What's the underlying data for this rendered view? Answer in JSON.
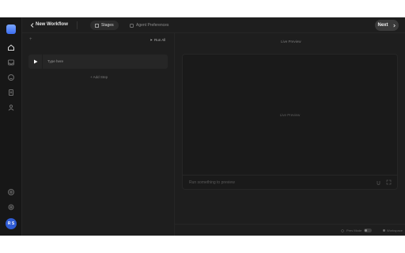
{
  "header": {
    "title": "New Workflow",
    "tabs": [
      {
        "label": "Stages",
        "active": true
      },
      {
        "label": "Agent Preferences",
        "active": false
      }
    ],
    "next_label": "Next"
  },
  "left_panel": {
    "run_all_label": "Run All",
    "steps": [
      {
        "text": "Type here"
      }
    ],
    "add_step_label": "+ Add Step"
  },
  "preview": {
    "label": "Live Preview",
    "center_text": "Live Preview",
    "input_placeholder": "Run something to preview"
  },
  "footer": {
    "toggle_label": "Prev Mode",
    "status_label": "Workspace"
  },
  "user": {
    "initials": "R S",
    "avatar_color": "#2f5bd3"
  },
  "sidebar": {
    "icons": [
      "home-icon",
      "inbox-icon",
      "smile-icon",
      "document-icon",
      "users-icon"
    ],
    "bottom_icons": [
      "help-icon",
      "settings-icon"
    ]
  }
}
